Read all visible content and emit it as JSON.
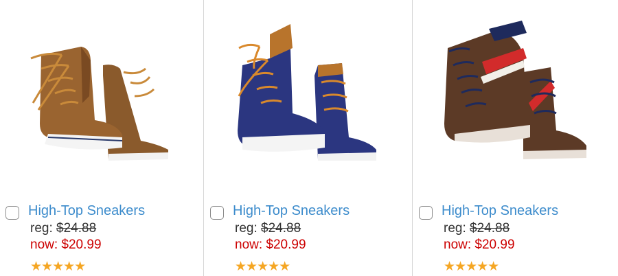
{
  "products": [
    {
      "title": "High-Top Sneakers",
      "reg_label": "reg:",
      "reg_price": "$24.88",
      "now_label": "now:",
      "now_price": "$20.99",
      "rating_stars": "★★★★★",
      "rating": 5,
      "shoe_color": "#9a6430",
      "accent_color": "#7a4a22",
      "lace_color": "#c98a3a"
    },
    {
      "title": "High-Top Sneakers",
      "reg_label": "reg:",
      "reg_price": "$24.88",
      "now_label": "now:",
      "now_price": "$20.99",
      "rating_stars": "★★★★★",
      "rating": 5,
      "shoe_color": "#2b3680",
      "accent_color": "#b8742c",
      "lace_color": "#d9892c"
    },
    {
      "title": "High-Top Sneakers",
      "reg_label": "reg:",
      "reg_price": "$24.88",
      "now_label": "now:",
      "now_price": "$20.99",
      "rating_stars": "★★★★★",
      "rating": 5,
      "shoe_color": "#5c3a26",
      "accent_color": "#d22b2b",
      "lace_color": "#1e2a5c"
    }
  ],
  "colors": {
    "link": "#3d8ccc",
    "sale": "#cc0000",
    "star": "#f5a623",
    "text": "#333333"
  }
}
